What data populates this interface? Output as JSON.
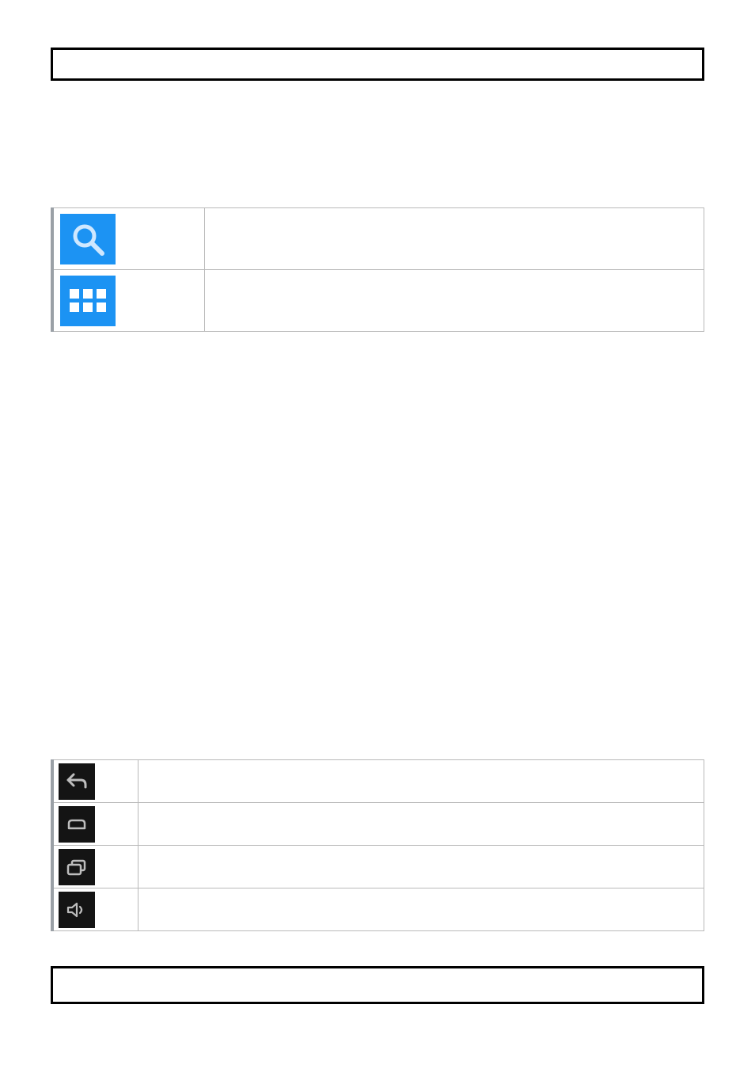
{
  "header": {
    "text": ""
  },
  "launcher_table": {
    "rows": [
      {
        "icon": "search-icon",
        "label": ""
      },
      {
        "icon": "apps-grid-icon",
        "label": ""
      }
    ]
  },
  "navbar_table": {
    "rows": [
      {
        "icon": "back-icon",
        "label": ""
      },
      {
        "icon": "home-icon",
        "label": ""
      },
      {
        "icon": "recent-apps-icon",
        "label": ""
      },
      {
        "icon": "volume-icon",
        "label": ""
      }
    ]
  },
  "footer": {
    "text": ""
  }
}
